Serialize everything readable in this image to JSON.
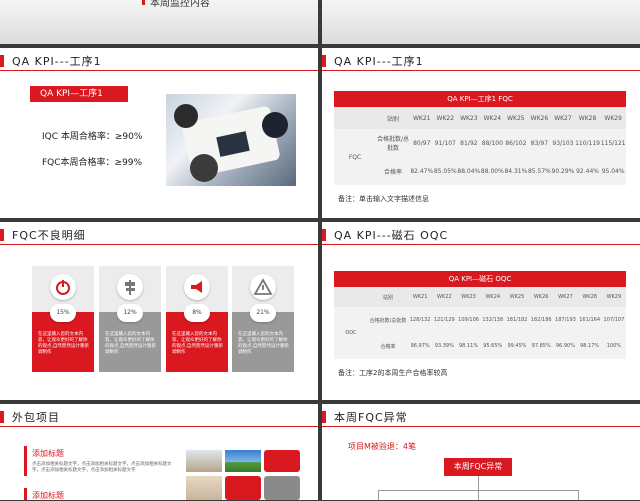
{
  "theme": {
    "accent": "#d9181f",
    "gray": "#999999"
  },
  "top": {
    "partial_title": "本周监控内容"
  },
  "slide1": {
    "title": "QA KPI---工序1",
    "badge": "QA KPI—工序1",
    "iqc": "IQC 本周合格率：≥90%",
    "fqc": "FQC本周合格率：≥99%"
  },
  "slide2": {
    "title": "QA KPI---工序1",
    "table_title": "QA KPI—工序1 FQC",
    "row_label": "FQC",
    "col_header": "站别",
    "weeks": [
      "WK21",
      "WK22",
      "WK23",
      "WK24",
      "WK25",
      "WK26",
      "WK27",
      "WK28",
      "WK29"
    ],
    "row1_label": "合格批数/总批数",
    "row1": [
      "80/97",
      "91/107",
      "81/92",
      "88/100",
      "86/102",
      "83/97",
      "93/103",
      "110/119",
      "115/121"
    ],
    "row2_label": "合格率",
    "row2": [
      "82.47%",
      "85.05%",
      "88.04%",
      "88.00%",
      "84.31%",
      "85.57%",
      "90.29%",
      "92.44%",
      "95.04%"
    ],
    "note": "备注：单击输入文字描述信息"
  },
  "slide3": {
    "title": "FQC不良明细",
    "cards": [
      {
        "pct": "15%",
        "desc": "在这里输入您的文本内容，让观众更好的了解你的观点,自然而然设计重新调制作",
        "icon": "power-icon"
      },
      {
        "pct": "12%",
        "desc": "在这里输入您的文本内容，让观众更好的了解你的观点,自然而然设计重新调制作",
        "icon": "signpost-icon"
      },
      {
        "pct": "8%",
        "desc": "在这里输入您的文本内容，让观众更好的了解你的观点,自然而然设计重新调制作",
        "icon": "megaphone-icon"
      },
      {
        "pct": "21%",
        "desc": "在这里输入您的文本内容，让观众更好的了解你的观点,自然而然设计重新调制作",
        "icon": "warning-icon"
      }
    ]
  },
  "slide4": {
    "title": "QA KPI---磁石 OQC",
    "table_title": "QA KPI—磁石 OQC",
    "row_label": "OQC",
    "col_header": "站别",
    "weeks": [
      "WK21",
      "WK22",
      "WK23",
      "WK24",
      "WK25",
      "WK26",
      "WK27",
      "WK28",
      "WK29"
    ],
    "row1_label": "合格批数/总批数",
    "row1": [
      "128/132",
      "121/129",
      "109/106",
      "132/138",
      "181/182",
      "182/186",
      "187/193",
      "161/164",
      "107/107"
    ],
    "row2_label": "合格率",
    "row2": [
      "96.97%",
      "93.39%",
      "98.11%",
      "95.65%",
      "99.45%",
      "97.85%",
      "96.90%",
      "98.17%",
      "100%"
    ],
    "note": "备注：工序2的本周生产合格率较高"
  },
  "slide5": {
    "title": "外包项目",
    "items": [
      {
        "heading": "添加标题",
        "desc": "点击添加相关标题文字，点击添加相关标题文字，点击添加相关标题文字，点击添加相关标题文字，点击添加相关标题文字"
      },
      {
        "heading": "添加标题",
        "desc": ""
      }
    ]
  },
  "slide6": {
    "title": "本周FQC异常",
    "project": "项目M被验退：4笔",
    "box": "本周FQC异常"
  }
}
